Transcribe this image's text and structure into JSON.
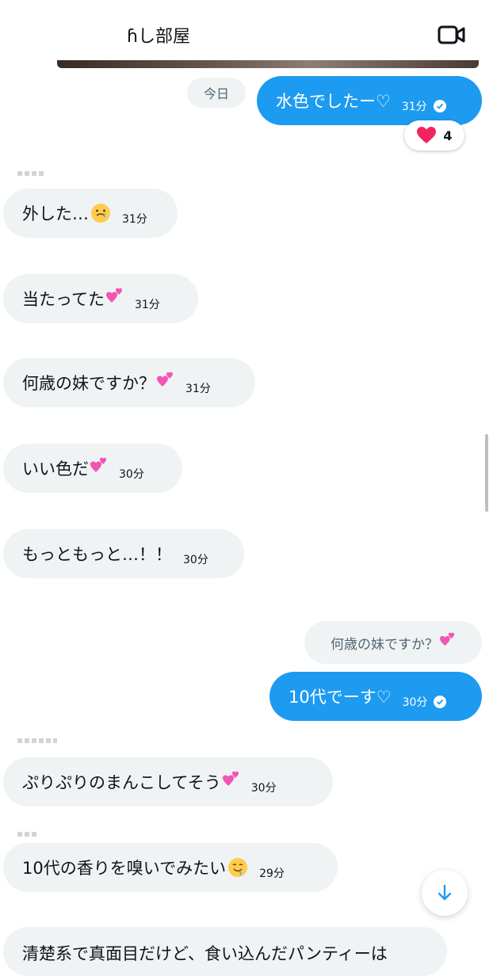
{
  "header": {
    "title": "ɦし部屋"
  },
  "date_separator": "今日",
  "messages": [
    {
      "side": "out",
      "text": "水色でしたー♡",
      "time": "31分"
    },
    {
      "side": "in",
      "text": "外した…",
      "time": "31分"
    },
    {
      "side": "in",
      "text": "当たってた",
      "time": "31分"
    },
    {
      "side": "in",
      "text": "何歳の妹ですか？",
      "time": "31分"
    },
    {
      "side": "in",
      "text": "いい色だ",
      "time": "30分"
    },
    {
      "side": "in",
      "text": "もっともっと…！！",
      "time": "30分"
    },
    {
      "side": "out",
      "text": "10代でーす♡",
      "time": "30分"
    },
    {
      "side": "in",
      "text": "ぷりぷりのまんこしてそう",
      "time": "30分"
    },
    {
      "side": "in",
      "text": "10代の香りを嗅いでみたい",
      "time": "29分"
    },
    {
      "side": "in",
      "text": "清楚系で真面目だけど、食い込んだパンティーは"
    }
  ],
  "reaction": {
    "emoji": "heart",
    "count": "4"
  },
  "quoted_reply": "何歳の妹ですか？",
  "icons": {
    "video": "video-call-icon",
    "scroll": "arrow-down-icon",
    "read": "check-circle-icon"
  },
  "colors": {
    "accent": "#1d9bf0",
    "incoming_bubble": "#eff3f4",
    "heart": "#f4245e"
  }
}
